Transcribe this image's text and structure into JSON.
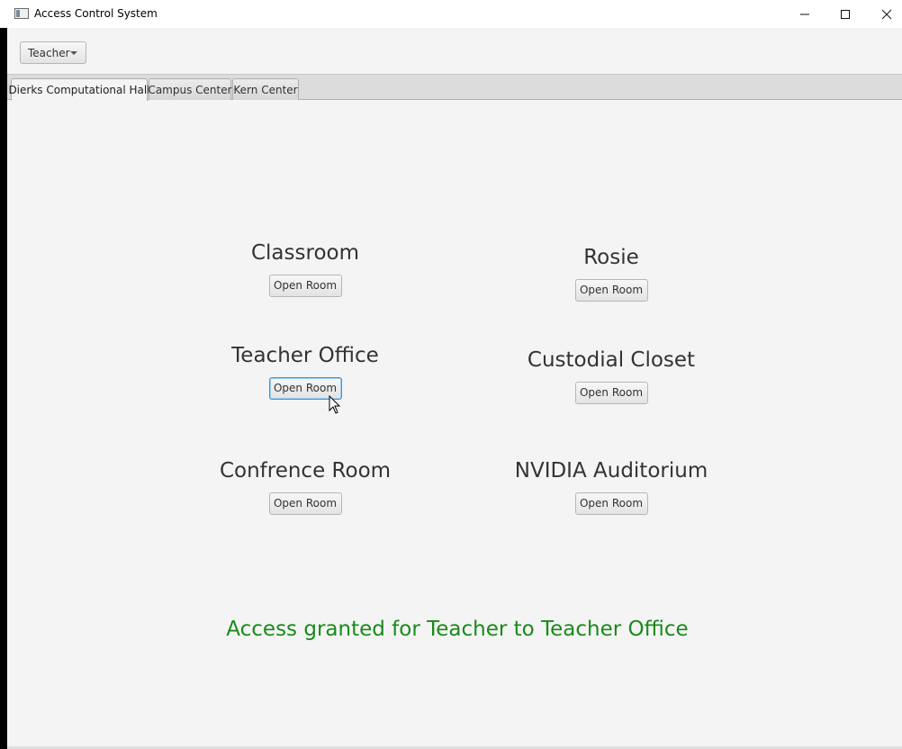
{
  "window": {
    "title": "Access Control System"
  },
  "toolbar": {
    "role_selected": "Teacher"
  },
  "tabs": [
    {
      "label": "Dierks Computational Hall",
      "active": true
    },
    {
      "label": "Campus Center",
      "active": false
    },
    {
      "label": "Kern Center",
      "active": false
    }
  ],
  "rooms": [
    {
      "name": "Classroom",
      "button": "Open Room"
    },
    {
      "name": "Rosie",
      "button": "Open Room"
    },
    {
      "name": "Teacher Office",
      "button": "Open Room"
    },
    {
      "name": "Custodial Closet",
      "button": "Open Room"
    },
    {
      "name": "Confrence Room",
      "button": "Open Room"
    },
    {
      "name": "NVIDIA Auditorium",
      "button": "Open Room"
    }
  ],
  "status": {
    "message": "Access granted for Teacher to Teacher Office",
    "color": "#1a8a1a"
  },
  "icons": {
    "app": "app-window-icon",
    "minimize": "minimize-icon",
    "maximize": "maximize-icon",
    "close": "close-icon",
    "dropdown": "chevron-down-icon",
    "cursor": "mouse-pointer-icon"
  }
}
